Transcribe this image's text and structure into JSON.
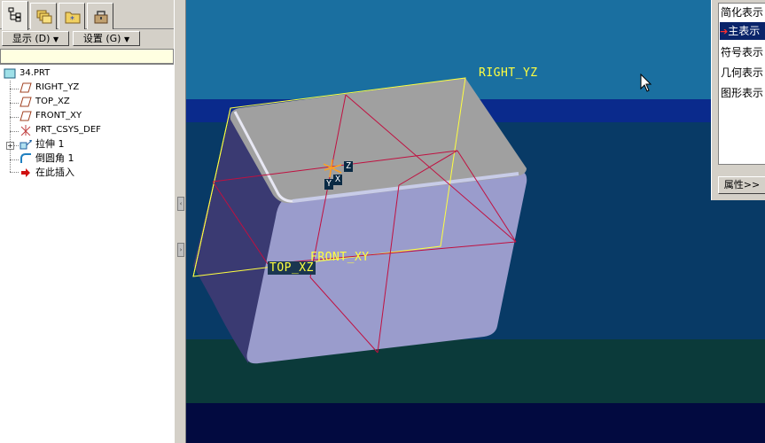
{
  "left_panel": {
    "tabs": [
      {
        "icon": "model-tree-icon",
        "active": true
      },
      {
        "icon": "folder-stack-icon",
        "active": false
      },
      {
        "icon": "favorites-folder-icon",
        "active": false
      },
      {
        "icon": "connections-toolbox-icon",
        "active": false
      }
    ],
    "display_button": "显示",
    "display_shortcut": "(D)",
    "settings_button": "设置",
    "settings_shortcut": "(G)",
    "tree": {
      "root": "34.PRT",
      "items": [
        {
          "label": "RIGHT_YZ",
          "icon": "datum-plane-icon"
        },
        {
          "label": "TOP_XZ",
          "icon": "datum-plane-icon"
        },
        {
          "label": "FRONT_XY",
          "icon": "datum-plane-icon"
        },
        {
          "label": "PRT_CSYS_DEF",
          "icon": "coordinate-system-icon"
        },
        {
          "label": "拉伸 1",
          "icon": "extrude-icon"
        },
        {
          "label": "倒圆角 1",
          "icon": "round-icon"
        },
        {
          "label": "在此插入",
          "icon": "insert-here-arrow-icon"
        }
      ]
    }
  },
  "viewport": {
    "labels": {
      "right": "RIGHT_YZ",
      "front": "FRONT_XY",
      "top": "TOP_XZ"
    },
    "axes": {
      "z": "Z",
      "x": "X",
      "y": "Y"
    },
    "colors": {
      "background_top": "#1a6fa0",
      "background_band": "#0a2a8c",
      "background_mid": "#083a66",
      "background_low": "#0b3a3a",
      "background_bottom": "#020a40",
      "part_top": "#a0a0a0",
      "part_front": "#9a9ccc",
      "part_side": "#3a3a72",
      "datum_yellow": "#ffff40",
      "datum_red": "#c01040"
    }
  },
  "rep_panel": {
    "items": [
      {
        "label": "简化表示",
        "selected": false
      },
      {
        "label": "主表示",
        "selected": true
      },
      {
        "label": "符号表示",
        "selected": false
      },
      {
        "label": "几何表示",
        "selected": false
      },
      {
        "label": "图形表示",
        "selected": false
      }
    ],
    "properties_button": "属性>>"
  }
}
